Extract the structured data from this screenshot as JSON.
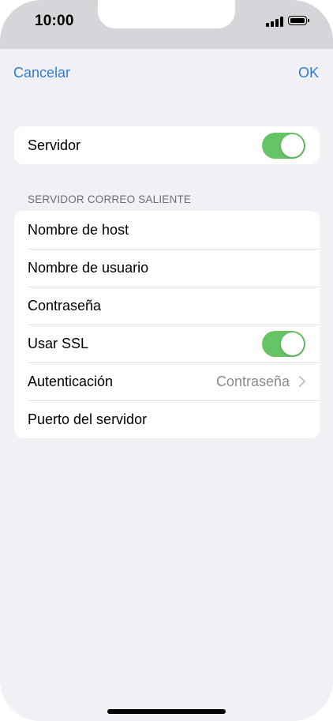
{
  "status_bar": {
    "time": "10:00",
    "icons": [
      "cellular-signal-icon",
      "battery-icon"
    ]
  },
  "nav": {
    "cancel_label": "Cancelar",
    "ok_label": "OK"
  },
  "server_group": {
    "server_label": "Servidor",
    "server_toggle_on": true
  },
  "outgoing": {
    "header": "SERVIDOR CORREO SALIENTE",
    "rows": [
      {
        "label": "Nombre de host"
      },
      {
        "label": "Nombre de usuario"
      },
      {
        "label": "Contraseña"
      },
      {
        "label": "Usar SSL",
        "toggle_on": true
      },
      {
        "label": "Autenticación",
        "value": "Contraseña"
      },
      {
        "label": "Puerto del servidor"
      }
    ]
  },
  "colors": {
    "accent": "#2f7bd6",
    "toggle_on": "#65c466",
    "background": "#f0f0f5"
  }
}
